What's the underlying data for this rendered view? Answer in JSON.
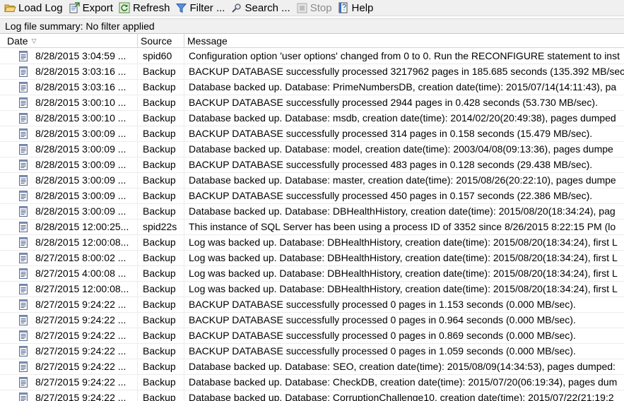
{
  "toolbar": {
    "load_log": "Load Log",
    "export": "Export",
    "refresh": "Refresh",
    "filter": "Filter ...",
    "search": "Search ...",
    "stop": "Stop",
    "help": "Help"
  },
  "summary": "Log file summary: No filter applied",
  "columns": {
    "date": "Date",
    "source": "Source",
    "message": "Message"
  },
  "rows": [
    {
      "date": "8/28/2015 3:04:59 ...",
      "source": "spid60",
      "message": "Configuration option 'user options' changed from 0 to 0. Run the RECONFIGURE statement to inst"
    },
    {
      "date": "8/28/2015 3:03:16 ...",
      "source": "Backup",
      "message": "BACKUP DATABASE successfully processed 3217962 pages in 185.685 seconds (135.392 MB/sec"
    },
    {
      "date": "8/28/2015 3:03:16 ...",
      "source": "Backup",
      "message": "Database backed up. Database: PrimeNumbersDB, creation date(time): 2015/07/14(14:11:43), pa"
    },
    {
      "date": "8/28/2015 3:00:10 ...",
      "source": "Backup",
      "message": "BACKUP DATABASE successfully processed 2944 pages in 0.428 seconds (53.730 MB/sec)."
    },
    {
      "date": "8/28/2015 3:00:10 ...",
      "source": "Backup",
      "message": "Database backed up. Database: msdb, creation date(time): 2014/02/20(20:49:38), pages dumped"
    },
    {
      "date": "8/28/2015 3:00:09 ...",
      "source": "Backup",
      "message": "BACKUP DATABASE successfully processed 314 pages in 0.158 seconds (15.479 MB/sec)."
    },
    {
      "date": "8/28/2015 3:00:09 ...",
      "source": "Backup",
      "message": "Database backed up. Database: model, creation date(time): 2003/04/08(09:13:36), pages dumpe"
    },
    {
      "date": "8/28/2015 3:00:09 ...",
      "source": "Backup",
      "message": "BACKUP DATABASE successfully processed 483 pages in 0.128 seconds (29.438 MB/sec)."
    },
    {
      "date": "8/28/2015 3:00:09 ...",
      "source": "Backup",
      "message": "Database backed up. Database: master, creation date(time): 2015/08/26(20:22:10), pages dumpe"
    },
    {
      "date": "8/28/2015 3:00:09 ...",
      "source": "Backup",
      "message": "BACKUP DATABASE successfully processed 450 pages in 0.157 seconds (22.386 MB/sec)."
    },
    {
      "date": "8/28/2015 3:00:09 ...",
      "source": "Backup",
      "message": "Database backed up. Database: DBHealthHistory, creation date(time): 2015/08/20(18:34:24), pag"
    },
    {
      "date": "8/28/2015 12:00:25...",
      "source": "spid22s",
      "message": "This instance of SQL Server has been using a process ID of 3352 since 8/26/2015 8:22:15 PM (lo"
    },
    {
      "date": "8/28/2015 12:00:08...",
      "source": "Backup",
      "message": "Log was backed up. Database: DBHealthHistory, creation date(time): 2015/08/20(18:34:24), first L"
    },
    {
      "date": "8/27/2015 8:00:02 ...",
      "source": "Backup",
      "message": "Log was backed up. Database: DBHealthHistory, creation date(time): 2015/08/20(18:34:24), first L"
    },
    {
      "date": "8/27/2015 4:00:08 ...",
      "source": "Backup",
      "message": "Log was backed up. Database: DBHealthHistory, creation date(time): 2015/08/20(18:34:24), first L"
    },
    {
      "date": "8/27/2015 12:00:08...",
      "source": "Backup",
      "message": "Log was backed up. Database: DBHealthHistory, creation date(time): 2015/08/20(18:34:24), first L"
    },
    {
      "date": "8/27/2015 9:24:22 ...",
      "source": "Backup",
      "message": "BACKUP DATABASE successfully processed 0 pages in 1.153 seconds (0.000 MB/sec)."
    },
    {
      "date": "8/27/2015 9:24:22 ...",
      "source": "Backup",
      "message": "BACKUP DATABASE successfully processed 0 pages in 0.964 seconds (0.000 MB/sec)."
    },
    {
      "date": "8/27/2015 9:24:22 ...",
      "source": "Backup",
      "message": "BACKUP DATABASE successfully processed 0 pages in 0.869 seconds (0.000 MB/sec)."
    },
    {
      "date": "8/27/2015 9:24:22 ...",
      "source": "Backup",
      "message": "BACKUP DATABASE successfully processed 0 pages in 1.059 seconds (0.000 MB/sec)."
    },
    {
      "date": "8/27/2015 9:24:22 ...",
      "source": "Backup",
      "message": "Database backed up. Database: SEO, creation date(time): 2015/08/09(14:34:53), pages dumped:"
    },
    {
      "date": "8/27/2015 9:24:22 ...",
      "source": "Backup",
      "message": "Database backed up. Database: CheckDB, creation date(time): 2015/07/20(06:19:34), pages dum"
    },
    {
      "date": "8/27/2015 9:24:22 ...",
      "source": "Backup",
      "message": "Database backed up. Database: CorruptionChallenge10, creation date(time): 2015/07/22(21:19:2"
    }
  ]
}
